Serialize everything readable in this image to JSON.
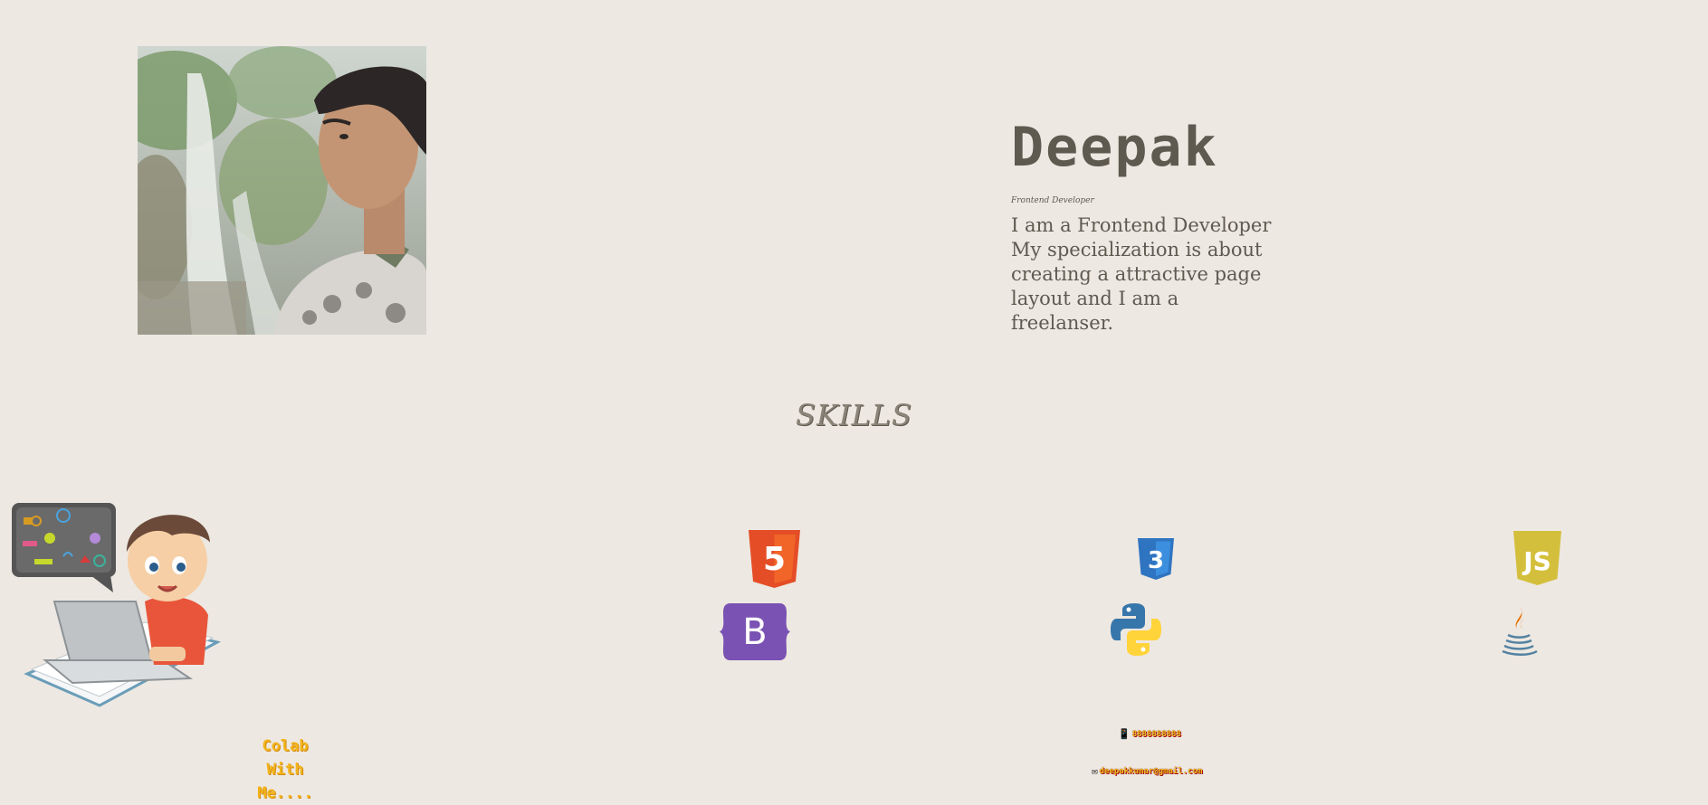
{
  "profile": {
    "name": "Deepak",
    "role": "Frontend Developer",
    "bio": "I am a Frontend Developer My specialization is about creating a attractive page layout and I am a freelanser."
  },
  "skills": {
    "title": "SKILLS",
    "items": [
      {
        "name": "HTML5",
        "icon": "html5-icon",
        "color": "#e44d26",
        "glyph": "5"
      },
      {
        "name": "CSS3",
        "icon": "css3-icon",
        "color": "#2f74c0",
        "glyph": "3"
      },
      {
        "name": "JavaScript",
        "icon": "javascript-icon",
        "color": "#d4bf3c",
        "glyph": "JS"
      },
      {
        "name": "Bootstrap",
        "icon": "bootstrap-icon",
        "color": "#7952b3",
        "glyph": "B"
      },
      {
        "name": "Python",
        "icon": "python-icon",
        "color": "#3776ab"
      },
      {
        "name": "Java",
        "icon": "java-icon",
        "color": "#e76f00"
      }
    ]
  },
  "collab": {
    "line1": "Colab",
    "line2": "With Me....",
    "color": "#f2b41c"
  },
  "contact": {
    "phone_icon": "📱",
    "phone": "8888888888",
    "email_icon": "✉",
    "email": "deepakkumar@gmail.com"
  },
  "colors": {
    "background": "#ede8e2",
    "text": "#5e5a50"
  }
}
